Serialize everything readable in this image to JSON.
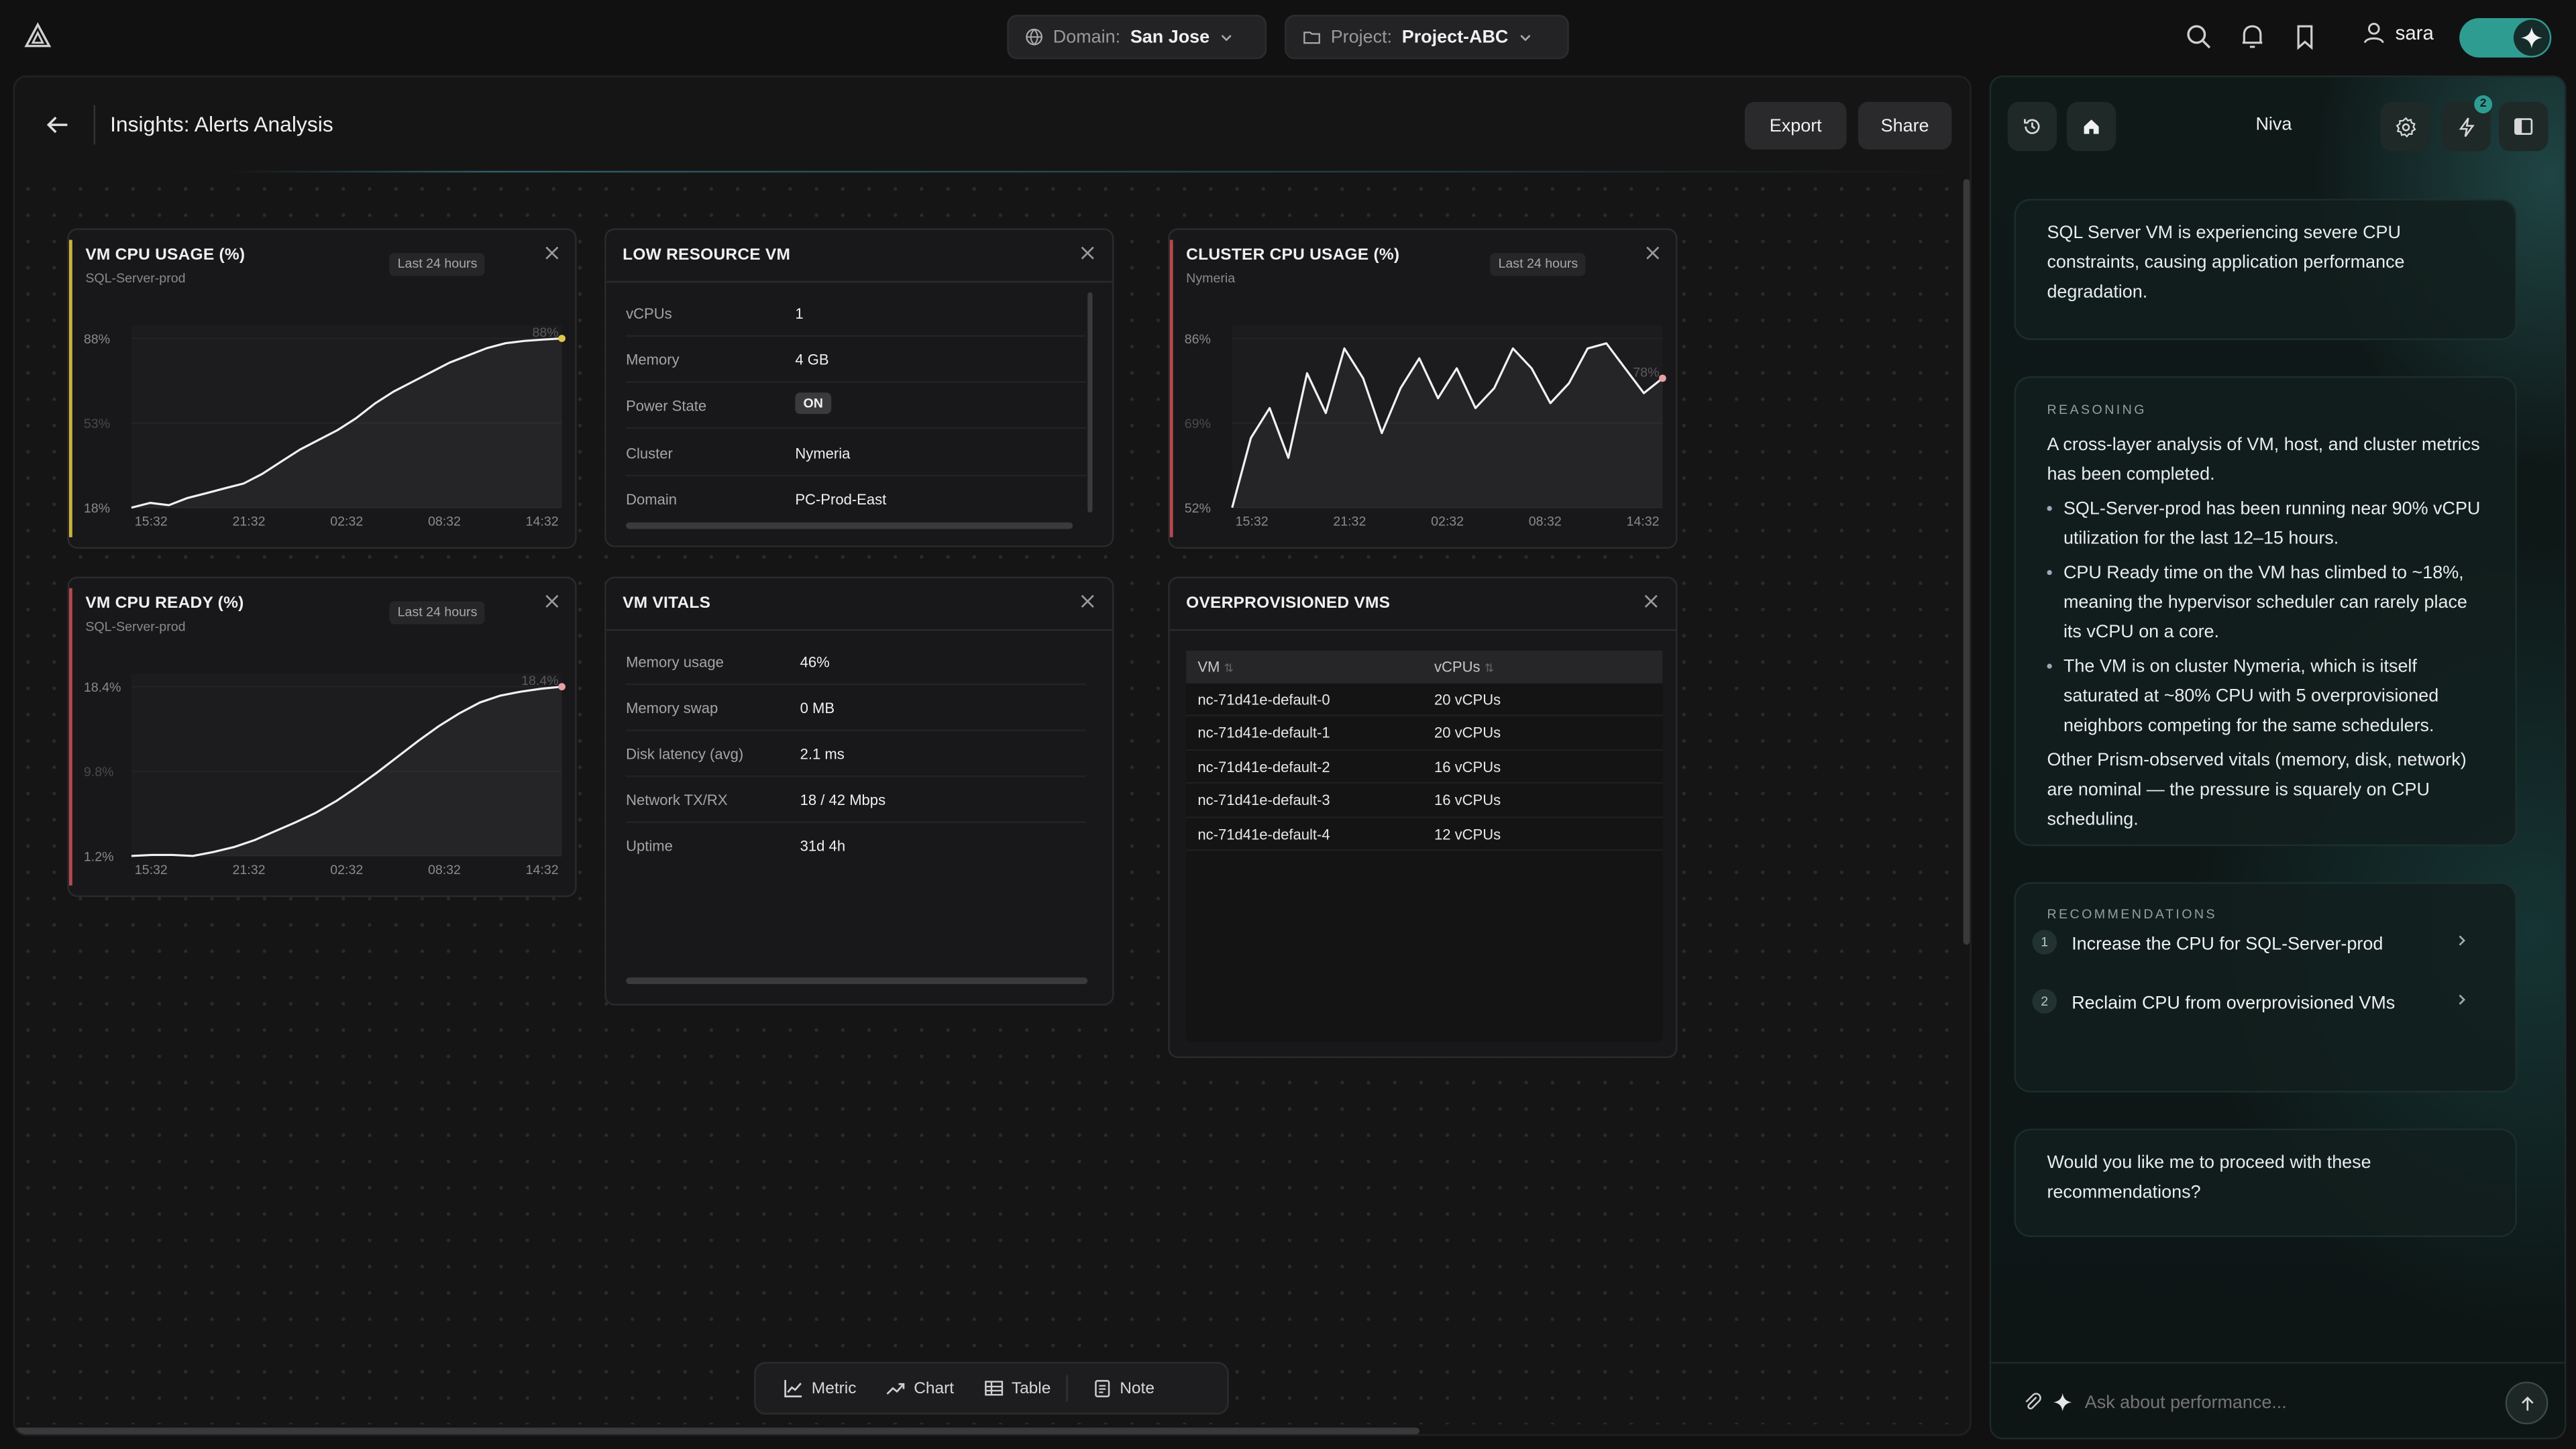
{
  "topbar": {
    "domain_key": "Domain:",
    "domain_value": "San Jose",
    "project_key": "Project:",
    "project_value": "Project-ABC",
    "user": "sara",
    "icons": [
      "logo-icon",
      "search-icon",
      "bell-icon",
      "bookmark-icon",
      "user-icon",
      "sparkle-icon"
    ]
  },
  "page": {
    "title": "Insights: Alerts Analysis",
    "export_label": "Export",
    "share_label": "Share"
  },
  "widgets": {
    "vm_cpu_usage": {
      "title": "VM CPU USAGE (%)",
      "subtitle": "SQL-Server-prod",
      "badge": "Last 24 hours",
      "accent": "#c9b53a",
      "y_ticks": [
        "88%",
        "53%",
        "18%"
      ],
      "end_label": "88%",
      "x_ticks": [
        "15:32",
        "21:32",
        "02:32",
        "08:32",
        "14:32"
      ]
    },
    "vm_cpu_ready": {
      "title": "VM CPU READY (%)",
      "subtitle": "SQL-Server-prod",
      "badge": "Last 24 hours",
      "accent": "#b8484e",
      "y_ticks": [
        "18.4%",
        "9.8%",
        "1.2%"
      ],
      "end_label": "18.4%",
      "x_ticks": [
        "15:32",
        "21:32",
        "02:32",
        "08:32",
        "14:32"
      ]
    },
    "cluster_cpu_usage": {
      "title": "CLUSTER CPU USAGE (%)",
      "subtitle": "Nymeria",
      "badge": "Last 24 hours",
      "accent": "#b8484e",
      "y_ticks": [
        "86%",
        "69%",
        "52%"
      ],
      "end_label": "78%",
      "x_ticks": [
        "15:32",
        "21:32",
        "02:32",
        "08:32",
        "14:32"
      ]
    },
    "low_resource_vm": {
      "title": "LOW RESOURCE VM",
      "rows": [
        {
          "k": "vCPUs",
          "v": "1"
        },
        {
          "k": "Memory",
          "v": "4 GB"
        },
        {
          "k": "Power State",
          "v": "ON"
        },
        {
          "k": "Cluster",
          "v": "Nymeria"
        },
        {
          "k": "Domain",
          "v": "PC-Prod-East"
        }
      ]
    },
    "vm_vitals": {
      "title": "VM VITALS",
      "rows": [
        {
          "k": "Memory usage",
          "v": "46%"
        },
        {
          "k": "Memory swap",
          "v": "0 MB"
        },
        {
          "k": "Disk latency (avg)",
          "v": "2.1 ms"
        },
        {
          "k": "Network TX/RX",
          "v": "18 / 42 Mbps"
        },
        {
          "k": "Uptime",
          "v": "31d 4h"
        }
      ]
    },
    "overprovisioned": {
      "title": "OVERPROVISIONED VMS",
      "col_vm": "VM",
      "col_vcpus": "vCPUs",
      "rows": [
        {
          "vm": "nc-71d41e-default-0",
          "vcpus": "20 vCPUs"
        },
        {
          "vm": "nc-71d41e-default-1",
          "vcpus": "20 vCPUs"
        },
        {
          "vm": "nc-71d41e-default-2",
          "vcpus": "16 vCPUs"
        },
        {
          "vm": "nc-71d41e-default-3",
          "vcpus": "16 vCPUs"
        },
        {
          "vm": "nc-71d41e-default-4",
          "vcpus": "12 vCPUs"
        }
      ]
    }
  },
  "toolbar": {
    "metric": "Metric",
    "chart": "Chart",
    "table": "Table",
    "note": "Note"
  },
  "assistant": {
    "name": "Niva",
    "notification_count": "2",
    "summary": "SQL Server VM is experiencing severe CPU constraints, causing application performance degradation.",
    "reasoning_label": "REASONING",
    "reasoning_intro": "A cross-layer analysis of VM, host, and cluster metrics has been completed.",
    "bullets": [
      "SQL-Server-prod has been running near 90% vCPU utilization for the last 12–15 hours.",
      "CPU Ready time on the VM has climbed to ~18%, meaning the hypervisor scheduler can rarely place its vCPU on a core.",
      "The VM is on cluster Nymeria, which is itself saturated at ~80% CPU with 5 overprovisioned neighbors competing for the same schedulers."
    ],
    "reasoning_outro": "Other Prism-observed vitals (memory, disk, network) are nominal — the pressure is squarely on CPU scheduling.",
    "recommendations_label": "RECOMMENDATIONS",
    "recommendations": [
      {
        "n": "1",
        "text": "Increase the CPU for SQL-Server-prod"
      },
      {
        "n": "2",
        "text": "Reclaim CPU from overprovisioned VMs"
      }
    ],
    "question": "Would you like me to proceed with these recommendations?",
    "input_placeholder": "Ask about performance..."
  },
  "chart_data": [
    {
      "type": "line",
      "title": "VM CPU USAGE (%)",
      "x": [
        "15:32",
        "21:32",
        "02:32",
        "08:32",
        "14:32"
      ],
      "ylim": [
        18,
        88
      ],
      "series": [
        {
          "values": [
            18,
            20,
            19,
            22,
            24,
            26,
            28,
            32,
            37,
            42,
            46,
            50,
            55,
            61,
            66,
            70,
            74,
            78,
            81,
            84,
            86,
            87,
            87.5,
            88
          ]
        }
      ]
    },
    {
      "type": "line",
      "title": "VM CPU READY (%)",
      "x": [
        "15:32",
        "21:32",
        "02:32",
        "08:32",
        "14:32"
      ],
      "ylim": [
        1.2,
        18.4
      ],
      "series": [
        {
          "values": [
            1.2,
            1.3,
            1.3,
            1.2,
            1.6,
            2.1,
            2.8,
            3.7,
            4.6,
            5.6,
            6.8,
            8.2,
            9.7,
            11.3,
            12.9,
            14.4,
            15.7,
            16.8,
            17.5,
            17.9,
            18.2,
            18.4
          ]
        }
      ]
    },
    {
      "type": "line",
      "title": "CLUSTER CPU USAGE (%)",
      "x": [
        "15:32",
        "21:32",
        "02:32",
        "08:32",
        "14:32"
      ],
      "ylim": [
        52,
        86
      ],
      "series": [
        {
          "values": [
            52,
            66,
            72,
            62,
            79,
            71,
            84,
            78,
            67,
            76,
            82,
            74,
            80,
            72,
            76,
            84,
            80,
            73,
            77,
            84,
            85,
            80,
            75,
            78
          ]
        }
      ]
    }
  ]
}
